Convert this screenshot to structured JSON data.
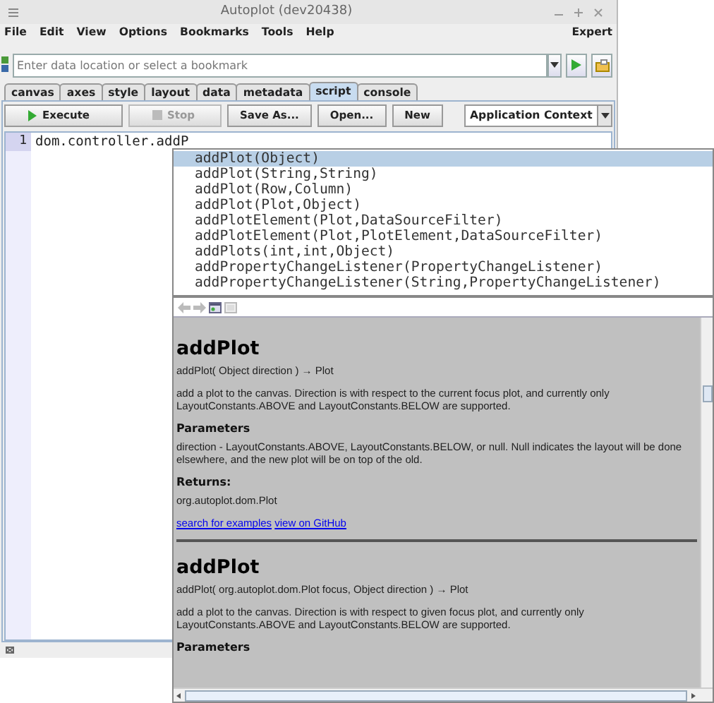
{
  "window": {
    "title": "Autoplot (dev20438)"
  },
  "menu": [
    "File",
    "Edit",
    "View",
    "Options",
    "Bookmarks",
    "Tools",
    "Help"
  ],
  "menu_right": "Expert",
  "address": {
    "placeholder": "Enter data location or select a bookmark"
  },
  "tabs": [
    {
      "label": "canvas",
      "selected": false
    },
    {
      "label": "axes",
      "selected": false
    },
    {
      "label": "style",
      "selected": false
    },
    {
      "label": "layout",
      "selected": false
    },
    {
      "label": "data",
      "selected": false
    },
    {
      "label": "metadata",
      "selected": false
    },
    {
      "label": "script",
      "selected": true
    },
    {
      "label": "console",
      "selected": false
    }
  ],
  "toolbar": {
    "buttons": [
      {
        "label": "Execute",
        "kind": "run",
        "disabled": false
      },
      {
        "label": "Stop",
        "kind": "stop",
        "disabled": true
      },
      {
        "label": "Save As...",
        "kind": "plain",
        "disabled": false
      },
      {
        "label": "Open...",
        "kind": "plain",
        "disabled": false
      },
      {
        "label": "New",
        "kind": "plain",
        "disabled": false
      }
    ],
    "context": "Application Context"
  },
  "editor": {
    "lines": [
      {
        "number": "1",
        "code": "dom.controller.addP"
      }
    ]
  },
  "completions": [
    {
      "label": "addPlot(Object)",
      "selected": true
    },
    {
      "label": "addPlot(String,String)",
      "selected": false
    },
    {
      "label": "addPlot(Row,Column)",
      "selected": false
    },
    {
      "label": "addPlot(Plot,Object)",
      "selected": false
    },
    {
      "label": "addPlotElement(Plot,DataSourceFilter)",
      "selected": false
    },
    {
      "label": "addPlotElement(Plot,PlotElement,DataSourceFilter)",
      "selected": false
    },
    {
      "label": "addPlots(int,int,Object)",
      "selected": false
    },
    {
      "label": "addPropertyChangeListener(PropertyChangeListener)",
      "selected": false
    },
    {
      "label": "addPropertyChangeListener(String,PropertyChangeListener)",
      "selected": false
    }
  ],
  "doc": {
    "entries": [
      {
        "title": "addPlot",
        "signature": "addPlot( Object direction ) → Plot",
        "description": "add a plot to the canvas. Direction is with respect to the current focus plot, and currently only LayoutConstants.ABOVE and LayoutConstants.BELOW are supported.",
        "sections": [
          {
            "heading": "Parameters",
            "text": "direction - LayoutConstants.ABOVE, LayoutConstants.BELOW, or null. Null indicates the layout will be done elsewhere, and the new plot will be on top of the old."
          },
          {
            "heading": "Returns:",
            "text": "org.autoplot.dom.Plot"
          }
        ],
        "links": [
          "search for examples",
          "view on GitHub"
        ]
      },
      {
        "title": "addPlot",
        "signature": "addPlot( org.autoplot.dom.Plot focus, Object direction ) → Plot",
        "description": "add a plot to the canvas. Direction is with respect to given focus plot, and currently only LayoutConstants.ABOVE and LayoutConstants.BELOW are supported.",
        "sections": [
          {
            "heading": "Parameters"
          }
        ]
      }
    ]
  }
}
